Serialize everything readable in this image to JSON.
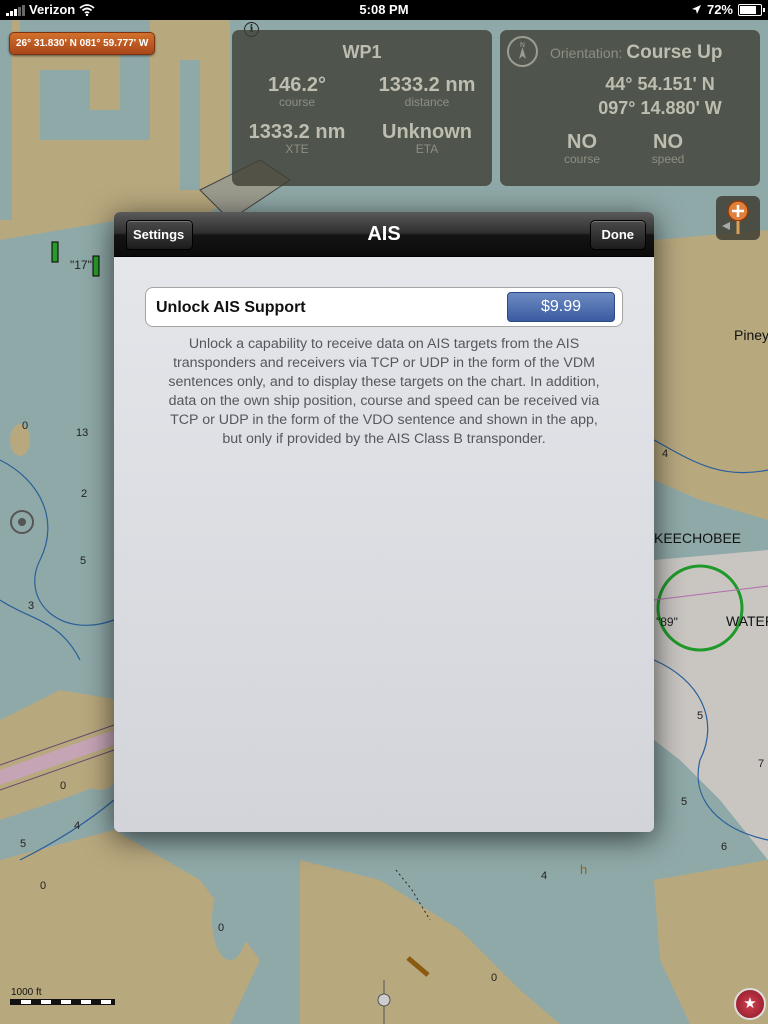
{
  "status_bar": {
    "carrier": "Verizon",
    "time": "5:08 PM",
    "battery": "72%",
    "battery_level": 0.72
  },
  "map": {
    "position_badge": "26° 31.830' N 081° 59.777' W",
    "info_symbol": "i",
    "scale_label": "1000 ft",
    "place_labels": [
      "Piney",
      "KEECHOBEE",
      "WATEF",
      "\"89\"",
      "\"17\""
    ],
    "depth_soundings": [
      "0",
      "13",
      "2",
      "5",
      "3",
      "0",
      "4",
      "5",
      "0",
      "0",
      "4",
      "5",
      "7",
      "5",
      "6",
      "4",
      "0",
      "h"
    ]
  },
  "waypoint_panel": {
    "title": "WP1",
    "course_value": "146.2°",
    "course_label": "course",
    "distance_value": "1333.2 nm",
    "distance_label": "distance",
    "xte_value": "1333.2 nm",
    "xte_label": "XTE",
    "eta_value": "Unknown",
    "eta_label": "ETA"
  },
  "orientation_panel": {
    "label": "Orientation:",
    "value": "Course Up",
    "latitude": "44° 54.151' N",
    "longitude": "097° 14.880' W",
    "course_value": "NO",
    "course_label": "course",
    "speed_value": "NO",
    "speed_label": "speed"
  },
  "modal": {
    "title": "AIS",
    "back_label": "Settings",
    "done_label": "Done",
    "purchase_label": "Unlock AIS Support",
    "price": "$9.99",
    "description": "Unlock a capability to receive data on AIS targets from the AIS transponders and receivers via TCP or UDP in the form of the VDM sentences only, and to display these targets on the chart. In addition, data on the own ship position, course and speed can be received via TCP or UDP in the form of the VDO sentence and shown in the app, but only if provided by the AIS Class B transponder."
  },
  "colors": {
    "land": "#b8a87e",
    "water": "#8fa9a8",
    "shallow": "#aab8b0",
    "modal_button": "#3a5ba0",
    "badge": "#c25c22"
  }
}
